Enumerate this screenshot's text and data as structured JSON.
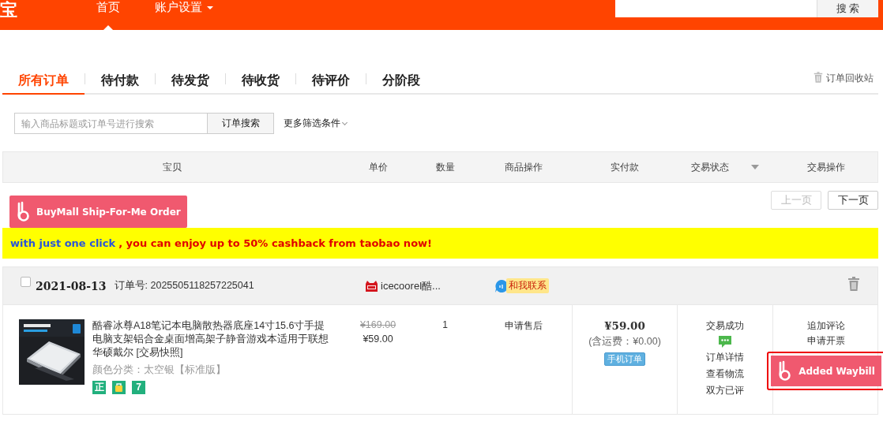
{
  "topbar": {
    "logo": "宝",
    "nav": [
      {
        "label": "首页",
        "selected": true,
        "dropdown": false
      },
      {
        "label": "账户设置",
        "selected": false,
        "dropdown": true
      }
    ],
    "search": {
      "button": "搜 索"
    }
  },
  "tabs": [
    {
      "label": "所有订单",
      "selected": true
    },
    {
      "label": "待付款",
      "selected": false
    },
    {
      "label": "待发货",
      "selected": false
    },
    {
      "label": "待收货",
      "selected": false
    },
    {
      "label": "待评价",
      "selected": false
    },
    {
      "label": "分阶段",
      "selected": false
    }
  ],
  "recycle_bin": "订单回收站",
  "order_search": {
    "placeholder": "输入商品标题或订单号进行搜索",
    "button": "订单搜索",
    "more_filters": "更多筛选条件"
  },
  "table": {
    "columns": [
      {
        "label": "宝贝",
        "sortable": false
      },
      {
        "label": "单价",
        "sortable": false
      },
      {
        "label": "数量",
        "sortable": false
      },
      {
        "label": "商品操作",
        "sortable": false
      },
      {
        "label": "实付款",
        "sortable": false
      },
      {
        "label": "交易状态",
        "sortable": true
      },
      {
        "label": "交易操作",
        "sortable": false
      }
    ]
  },
  "buymall_button": "BuyMall Ship-For-Me Order",
  "pager": [
    {
      "label": "上一页",
      "disabled": true
    },
    {
      "label": "下一页",
      "disabled": false
    }
  ],
  "banner": {
    "link": "with just one click",
    "message": ", you can enjoy up to 50% cashback from taobao now!"
  },
  "order": {
    "checked": false,
    "date": "2021-08-13",
    "order_no": "订单号: 2025505118257225041",
    "shop": "icecoorel酷...",
    "contact": "和我联系",
    "item": {
      "image": {
        "kind": "picture"
      },
      "title": "酷睿冰尊A18笔记本电脑散热器底座14寸15.6寸手提电脑支架铝合金桌面增高架子静音游戏本适用于联想华硕戴尔",
      "snapshot": "[交易快照]",
      "spec": "颜色分类：太空银【标准版】",
      "services": [
        {
          "kind": "text",
          "text": "正"
        },
        {
          "kind": "icon"
        },
        {
          "kind": "text",
          "text": "7"
        }
      ],
      "prices": [
        {
          "text": "¥169.00",
          "struck": true
        },
        {
          "text": "¥59.00",
          "struck": false
        }
      ],
      "quantity": "1",
      "item_actions": [
        "申请售后"
      ]
    },
    "total": "¥59.00",
    "shipping": "(含运费：¥0.00)",
    "source_tag": "手机订单",
    "status": [
      {
        "kind": "text",
        "text": "交易成功"
      },
      {
        "kind": "chat"
      },
      {
        "kind": "link",
        "text": "订单详情"
      },
      {
        "kind": "link",
        "text": "查看物流"
      },
      {
        "kind": "text",
        "text": "双方已评"
      }
    ],
    "actions": [
      "追加评论",
      "申请开票"
    ],
    "waybill_button": {
      "label": "Added Waybill",
      "highlighted": true
    }
  }
}
